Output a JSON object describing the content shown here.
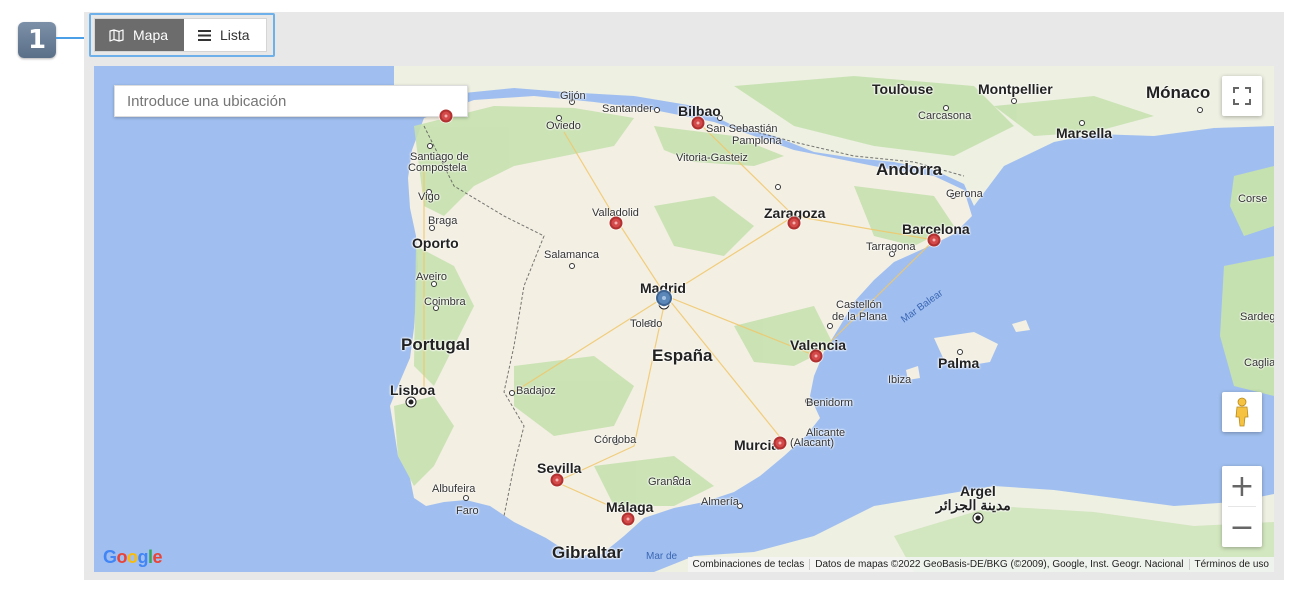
{
  "step_badge": "1",
  "view_toggle": {
    "map_label": "Mapa",
    "list_label": "Lista",
    "map_icon": "map-icon",
    "list_icon": "list-icon"
  },
  "search": {
    "placeholder": "Introduce una ubicación"
  },
  "map": {
    "countries": [
      "Portugal",
      "España",
      "Andorra",
      "Mónaco",
      "Gibraltar"
    ],
    "cities": [
      "Gijón",
      "Oviedo",
      "Santander",
      "Bilbao",
      "San Sebastián",
      "Pamplona",
      "Vitoria-Gasteiz",
      "Santiago de",
      "Compostela",
      "Vigo",
      "Braga",
      "Oporto",
      "Aveiro",
      "Coimbra",
      "Lisboa",
      "Valladolid",
      "Salamanca",
      "Madrid",
      "Toledo",
      "Badajoz",
      "Córdoba",
      "Sevilla",
      "Granada",
      "Málaga",
      "Almería",
      "Albufeira",
      "Faro",
      "Zaragoza",
      "Barcelona",
      "Tarragona",
      "Gerona",
      "Castellón",
      "de la Plana",
      "Valencia",
      "Palma",
      "Ibiza",
      "Benidorm",
      "Alicante",
      "(Alacant)",
      "Murcia",
      "Toulouse",
      "Carcasona",
      "Montpellier",
      "Marsella",
      "Corse",
      "Sardegna",
      "Cagliar",
      "Argel",
      "مدينة الجزائر"
    ],
    "seas": [
      "Mar Balear",
      "Mar de"
    ],
    "markers": {
      "red": [
        "Bilbao",
        "Valladolid",
        "Zaragoza",
        "Barcelona",
        "Valencia",
        "Murcia",
        "Sevilla",
        "Málaga",
        "Galicia"
      ],
      "blue": [
        "Madrid"
      ]
    },
    "controls": {
      "fullscreen_icon": "fullscreen-icon",
      "pegman_icon": "street-view-pegman-icon",
      "zoom_in": "+",
      "zoom_out": "−"
    },
    "logo": "Google",
    "attribution": {
      "shortcuts": "Combinaciones de teclas",
      "data": "Datos de mapas ©2022 GeoBasis-DE/BKG (©2009), Google, Inst. Geogr. Nacional",
      "terms": "Términos de uso"
    }
  },
  "colors": {
    "accent_outline": "#6db0ea",
    "active_toggle": "#6c6c6c",
    "sea": "#a0bff0",
    "land": "#f5f1e6",
    "vegetation": "#c3dfae",
    "marker_red": "#d44a4a",
    "marker_blue": "#5b86b8"
  }
}
